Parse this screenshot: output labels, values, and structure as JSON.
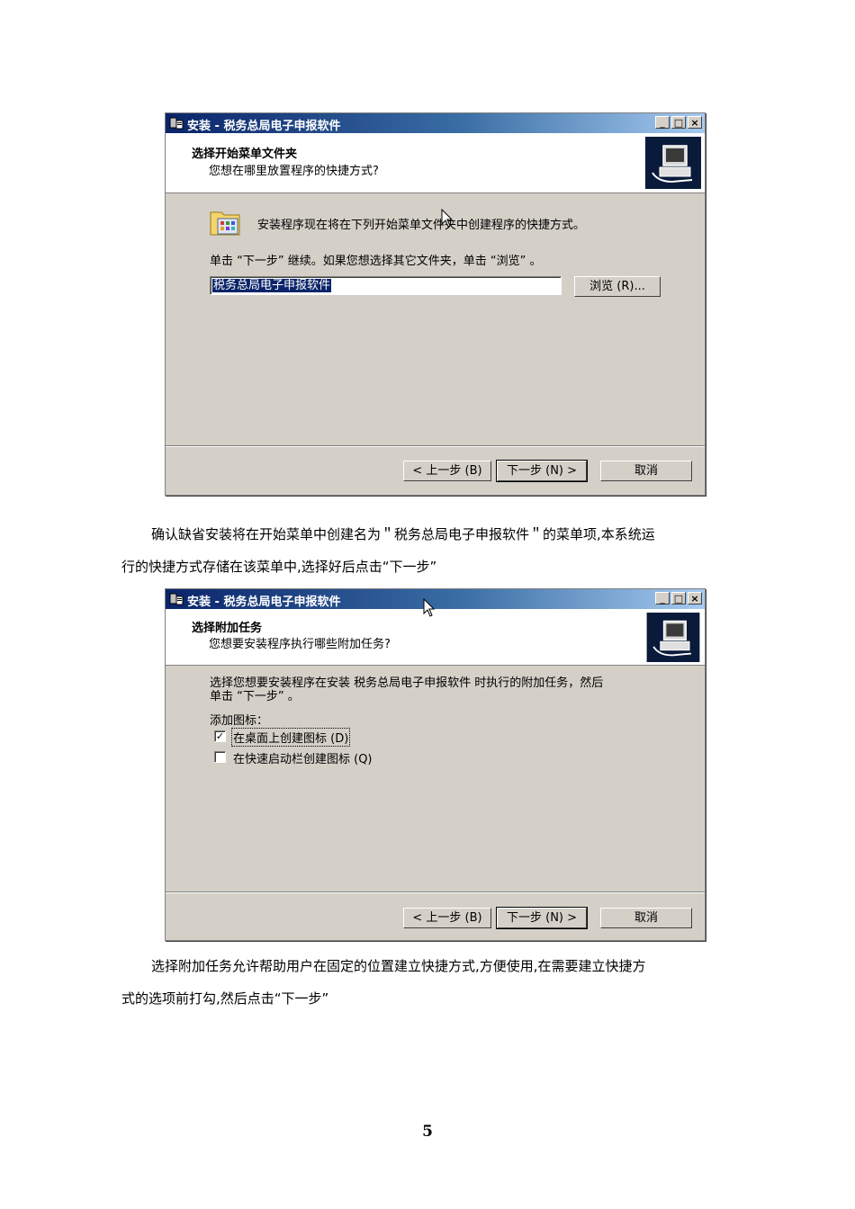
{
  "dialog1": {
    "title": "安装 - 税务总局电子申报软件",
    "header_title": "选择开始菜单文件夹",
    "header_subtitle": "您想在哪里放置程序的快捷方式?",
    "info_text": "安装程序现在将在下列开始菜单文件夹中创建程序的快捷方式。",
    "instruction": "单击 “下一步” 继续。如果您想选择其它文件夹，单击 “浏览” 。",
    "folder_value": "税务总局电子申报软件",
    "browse_label": "浏览 (R)...",
    "back_label": "< 上一步 (B)",
    "next_label": "下一步 (N) >",
    "cancel_label": "取消"
  },
  "caption1": {
    "line1": "确认缺省安装将在开始菜单中创建名为＂税务总局电子申报软件＂的菜单项,本系统运",
    "line2": "行的快捷方式存储在该菜单中,选择好后点击“下一步”"
  },
  "dialog2": {
    "title": "安装 - 税务总局电子申报软件",
    "header_title": "选择附加任务",
    "header_subtitle": "您想要安装程序执行哪些附加任务?",
    "desc_line1": "选择您想要安装程序在安装 税务总局电子申报软件 时执行的附加任务，然后",
    "desc_line2": "单击 “下一步” 。",
    "group_label": "添加图标：",
    "checkboxes": [
      {
        "label": "在桌面上创建图标 (D)",
        "checked": true
      },
      {
        "label": "在快速启动栏创建图标 (Q)",
        "checked": false
      }
    ],
    "back_label": "< 上一步 (B)",
    "next_label": "下一步 (N) >",
    "cancel_label": "取消"
  },
  "caption2": {
    "line1": "选择附加任务允许帮助用户在固定的位置建立快捷方式,方便使用,在需要建立快捷方",
    "line2": "式的选项前打勾,然后点击“下一步”"
  },
  "page_number": "5",
  "icons": [
    "setup-app-icon",
    "installer-computer-icon",
    "start-menu-folder-icon",
    "mouse-cursor-icon"
  ]
}
